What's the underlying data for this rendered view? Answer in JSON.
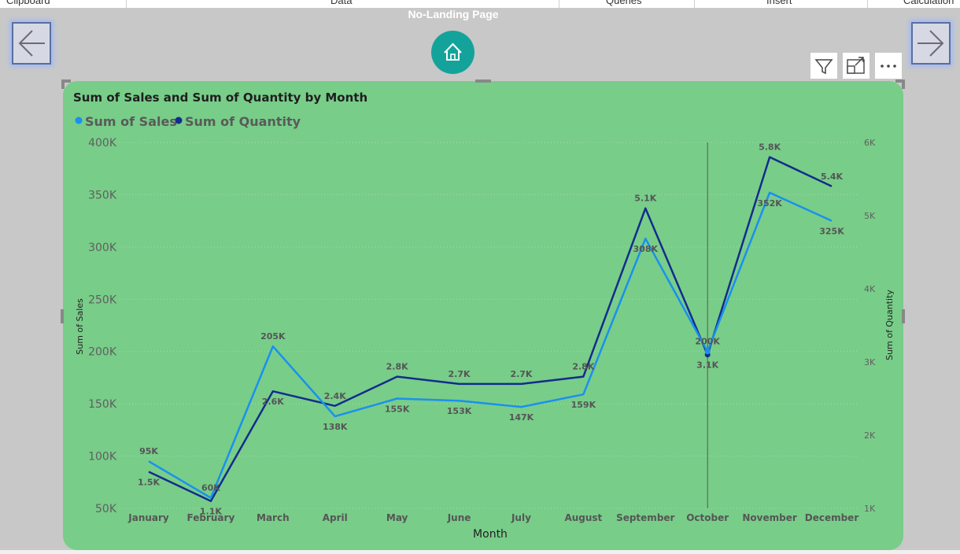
{
  "ribbon": {
    "groups": [
      "Clipboard",
      "Data",
      "Queries",
      "Insert",
      "Calculation"
    ]
  },
  "page": {
    "title": "No-Landing Page"
  },
  "nav": {
    "back": "arrow-left-icon",
    "forward": "arrow-right-icon",
    "home": "home-icon"
  },
  "visual_header": {
    "filter": "filter-icon",
    "focus": "focus-mode-icon",
    "more": "more-options-icon"
  },
  "colors": {
    "background": "#78cd89",
    "sales": "#1a90f0",
    "quantity": "#132c8c",
    "labels": "#555555"
  },
  "chart_data": {
    "type": "line",
    "title": "Sum of Sales and Sum of Quantity by Month",
    "xlabel": "Month",
    "ylabel": "Sum of Sales",
    "y2label": "Sum of Quantity",
    "ylim": [
      50000,
      400000
    ],
    "y2lim": [
      1000,
      6000
    ],
    "yticks": [
      "50K",
      "100K",
      "150K",
      "200K",
      "250K",
      "300K",
      "350K",
      "400K"
    ],
    "y2ticks": [
      "1K",
      "2K",
      "3K",
      "4K",
      "5K",
      "6K"
    ],
    "legend": "top-left",
    "grid": true,
    "categories": [
      "January",
      "February",
      "March",
      "April",
      "May",
      "June",
      "July",
      "August",
      "September",
      "October",
      "November",
      "December"
    ],
    "series": [
      {
        "name": "Sum of Sales",
        "axis": "left",
        "values": [
          95000,
          60000,
          205000,
          138000,
          155000,
          153000,
          147000,
          159000,
          308000,
          200000,
          352000,
          325000
        ],
        "labels": [
          "95K",
          "60K",
          "205K",
          "138K",
          "155K",
          "153K",
          "147K",
          "159K",
          "308K",
          "200K",
          "352K",
          "325K"
        ]
      },
      {
        "name": "Sum of Quantity",
        "axis": "right",
        "values": [
          1500,
          1100,
          2600,
          2400,
          2800,
          2700,
          2700,
          2800,
          5100,
          3100,
          5800,
          5400
        ],
        "labels": [
          "1.5K",
          "1.1K",
          "2.6K",
          "2.4K",
          "2.8K",
          "2.7K",
          "2.7K",
          "2.8K",
          "5.1K",
          "3.1K",
          "5.8K",
          "5.4K"
        ]
      }
    ],
    "highlighted_category": "October"
  }
}
